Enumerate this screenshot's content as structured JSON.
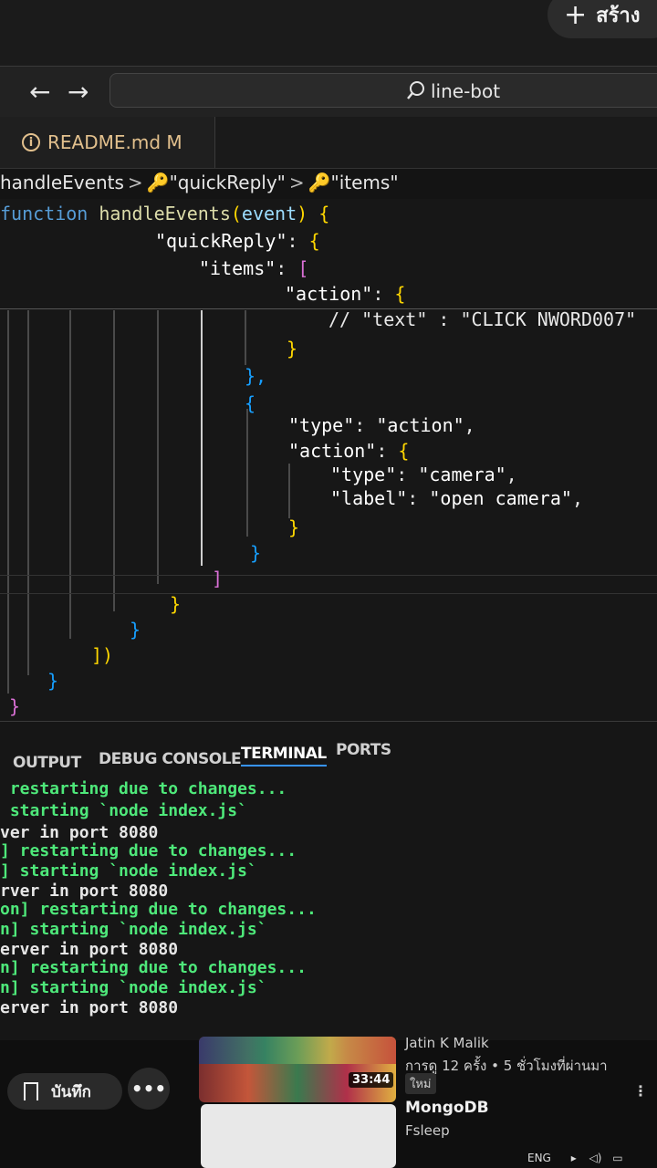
{
  "header": {
    "create_label": "สร้าง"
  },
  "titlebar": {
    "back_glyph": "←",
    "forward_glyph": "→",
    "search_text": "line-bot"
  },
  "tabs": [
    {
      "label": "README.md M",
      "modified": true
    }
  ],
  "breadcrumb": {
    "items": [
      "handleEvents",
      "\"quickReply\"",
      "\"items\""
    ],
    "separator": ">"
  },
  "code": {
    "line1": {
      "keyword": "function",
      "name": "handleEvents",
      "open": "(",
      "param": "event",
      "close": ")",
      "brace": "{"
    },
    "line2": {
      "key": "\"quickReply\"",
      "colon": ":",
      "brace": "{"
    },
    "line3": {
      "key": "\"items\"",
      "colon": ":",
      "bracket": "["
    },
    "line4": {
      "key": "\"action\"",
      "colon": ":",
      "brace": "{"
    },
    "line5": {
      "comment": "// \"text\" : \"CLICK NWORD007\""
    },
    "line6": "}",
    "line7": "},",
    "line8": "{",
    "line9": {
      "key": "\"type\"",
      "colon": ":",
      "value": "\"action\"",
      "comma": ","
    },
    "line10": {
      "key": "\"action\"",
      "colon": ":",
      "brace": "{"
    },
    "line11": {
      "key": "\"type\"",
      "colon": ":",
      "value": "\"camera\"",
      "comma": ","
    },
    "line12": {
      "key": "\"label\"",
      "colon": ":",
      "value": "\"open camera\"",
      "comma": ","
    },
    "line13": "}",
    "line14": "}",
    "line15": "]",
    "line16": "}",
    "line17": "}",
    "line18": "])",
    "line19": "}",
    "line20": "}"
  },
  "panel": {
    "tabs": [
      "OUTPUT",
      "DEBUG CONSOLE",
      "TERMINAL",
      "PORTS"
    ],
    "active_tab": "TERMINAL",
    "terminal_lines": [
      " restarting due to changes...",
      " starting `node index.js`",
      "ver in port 8080",
      "] restarting due to changes...",
      "] starting `node index.js`",
      "rver in port 8080",
      "on] restarting due to changes...",
      "n] starting `node index.js`",
      "erver in port 8080",
      "n] restarting due to changes...",
      "n] starting `node index.js`",
      "erver in port 8080"
    ]
  },
  "youtube": {
    "save_label": "บันทึก",
    "more_label": "•••",
    "video1": {
      "author": "Jatin K Malik",
      "meta": "การดู 12 ครั้ง • 5 ชั่วโมงที่ผ่านมา",
      "badge": "ใหม่",
      "duration": "33:44"
    },
    "video2": {
      "title": "MongoDB",
      "author": "Fsleep"
    },
    "menu_glyph": "⋮"
  },
  "taskbar": {
    "language": "ENG"
  },
  "colors": {
    "terminal_green": "#4ee87a",
    "tab_modified": "#e2c08d",
    "bracket_yellow": "#ffd700",
    "bracket_purple": "#da70d6",
    "bracket_blue": "#179fff"
  }
}
